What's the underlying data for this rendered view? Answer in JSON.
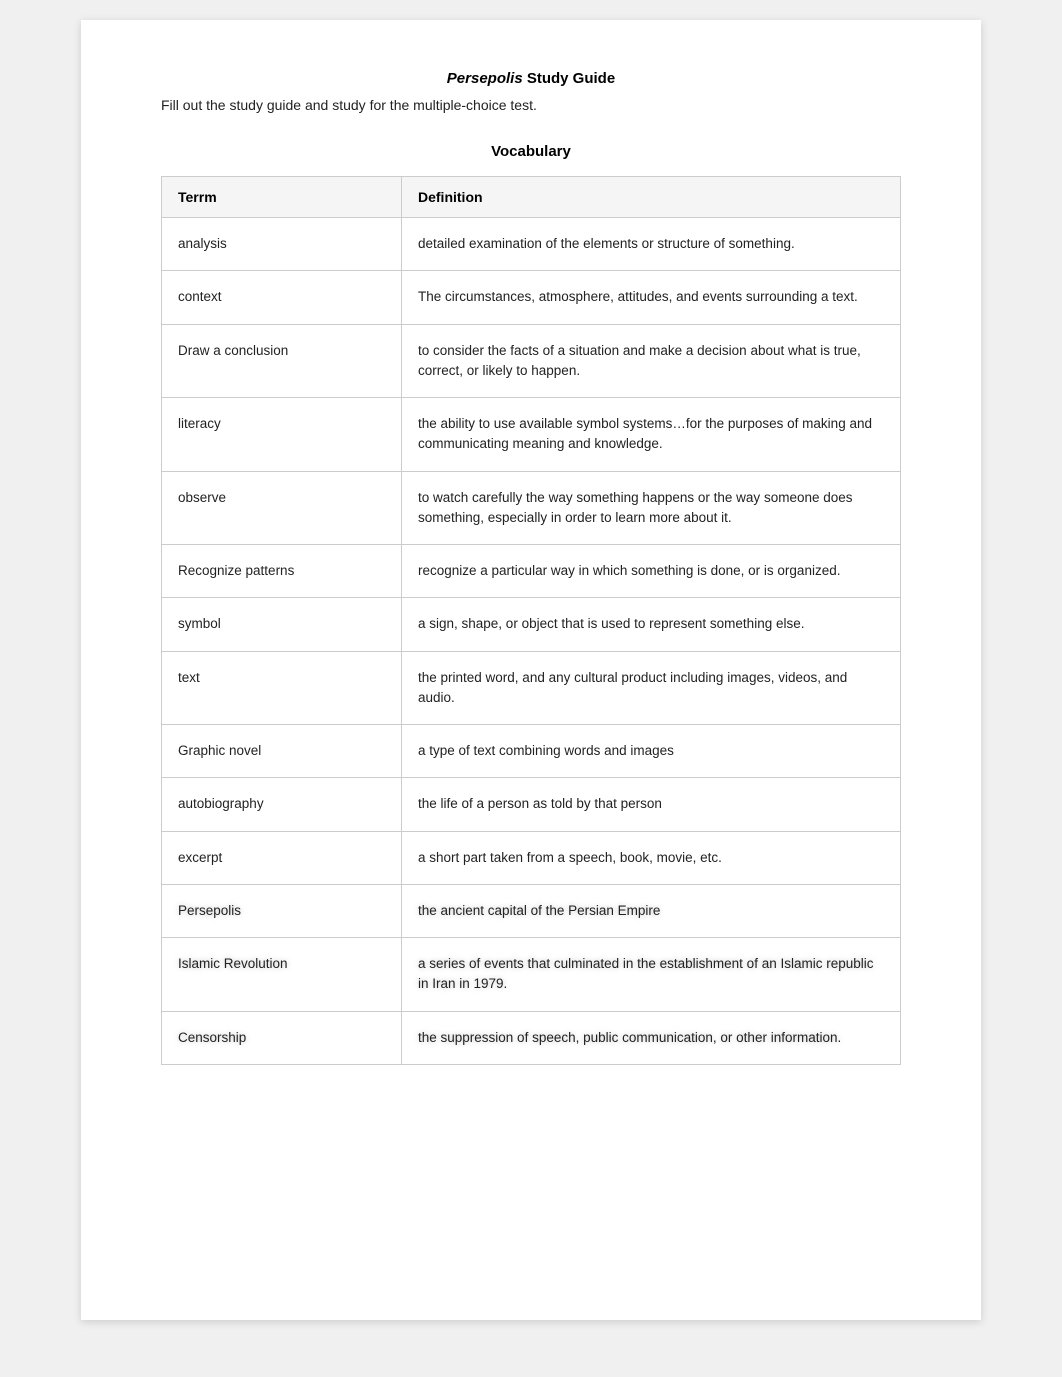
{
  "page": {
    "title_italic": "Persepolis",
    "title_rest": " Study Guide",
    "subtitle": "Fill out the study guide and study for the multiple-choice test.",
    "section_vocab": "Vocabulary"
  },
  "table": {
    "col1": "Terrm",
    "col2": "Definition",
    "rows": [
      {
        "term": "analysis",
        "definition": "detailed examination of the elements or structure of something.",
        "blurred": false,
        "excerpt": false
      },
      {
        "term": "context",
        "definition": "The circumstances, atmosphere, attitudes, and events surrounding a text.",
        "blurred": false,
        "excerpt": false
      },
      {
        "term": "Draw a conclusion",
        "definition": "to consider the facts of a situation and make a decision about what is true, correct, or likely to happen.",
        "blurred": false,
        "excerpt": false
      },
      {
        "term": "literacy",
        "definition": "the ability to use available symbol systems…for the purposes of making and communicating meaning and knowledge.",
        "blurred": false,
        "excerpt": false
      },
      {
        "term": "observe",
        "definition": "to watch carefully the way something happens or the way someone does something, especially in order to learn more about it.",
        "blurred": false,
        "excerpt": false
      },
      {
        "term": "Recognize patterns",
        "definition": "recognize a particular way in which something is done, or is organized.",
        "blurred": false,
        "excerpt": false
      },
      {
        "term": "symbol",
        "definition": "a sign, shape, or object that is used to represent something else.",
        "blurred": false,
        "excerpt": false
      },
      {
        "term": "text",
        "definition": "the printed word, and any cultural product including images, videos, and audio.",
        "blurred": false,
        "excerpt": false
      },
      {
        "term": "Graphic novel",
        "definition": "a type of text combining words and images",
        "blurred": false,
        "excerpt": false
      },
      {
        "term": "autobiography",
        "definition": "the life of a person as told by that person",
        "blurred": false,
        "excerpt": false
      },
      {
        "term": "excerpt",
        "definition": "a short part taken from a speech, book, movie, etc.",
        "blurred": false,
        "excerpt": true
      },
      {
        "term": "Persepolis",
        "definition": "the ancient capital of the Persian Empire",
        "blurred": true,
        "excerpt": false
      },
      {
        "term": "Islamic Revolution",
        "definition": "a series of events that culminated in the establishment of an Islamic republic in Iran in 1979.",
        "blurred": true,
        "excerpt": false
      },
      {
        "term": "Censorship",
        "definition": "the suppression of speech, public communication, or other information.",
        "blurred": true,
        "excerpt": false
      }
    ]
  }
}
